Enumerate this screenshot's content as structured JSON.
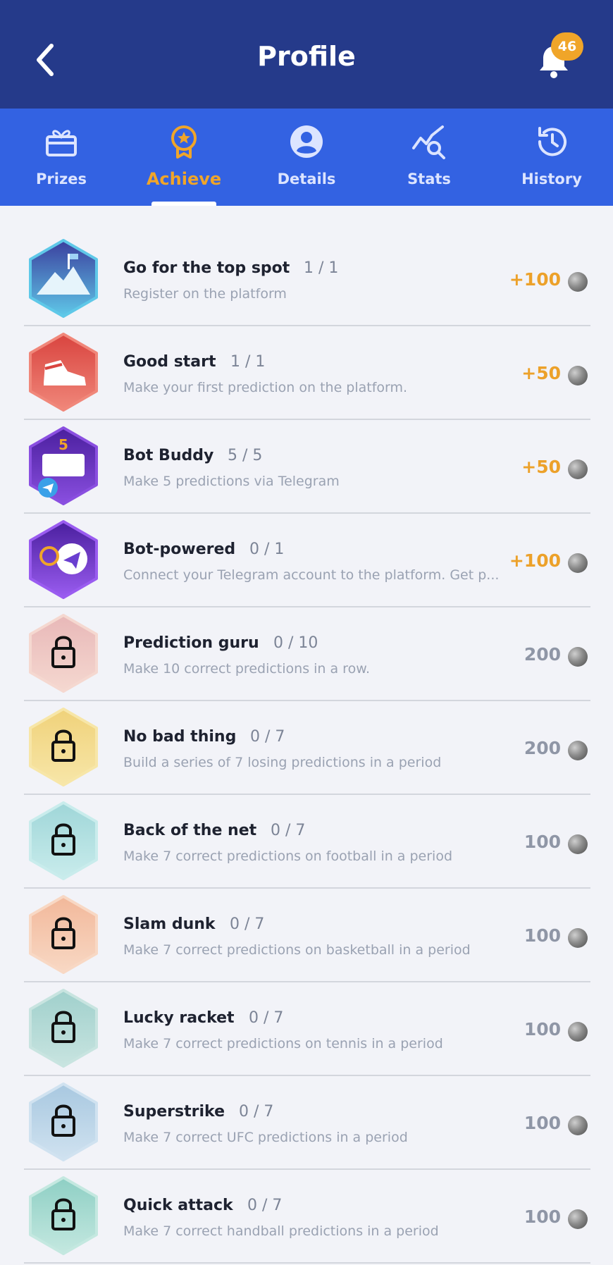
{
  "header": {
    "title": "Profile",
    "notification_count": "46"
  },
  "tabs": [
    {
      "label": "Prizes",
      "icon": "gift-icon",
      "active": false
    },
    {
      "label": "Achieve",
      "icon": "medal-icon",
      "active": true
    },
    {
      "label": "Details",
      "icon": "user-icon",
      "active": false
    },
    {
      "label": "Stats",
      "icon": "stats-chart-icon",
      "active": false
    },
    {
      "label": "History",
      "icon": "history-icon",
      "active": false
    }
  ],
  "colors": {
    "header_bg": "#253a8a",
    "tabbar_bg": "#3362e2",
    "accent": "#f0a529",
    "earned_reward": "#eca12a",
    "locked_reward": "#8f96a6"
  },
  "achievements": [
    {
      "name": "Go for the top spot",
      "progress": "1 / 1",
      "description": "Register on the platform",
      "reward": "+100",
      "earned": true,
      "badge": "mountain-flag-badge",
      "c1": "#3b3f9e",
      "c2": "#5fc8e8"
    },
    {
      "name": "Good start",
      "progress": "1 / 1",
      "description": "Make your first prediction on the platform.",
      "reward": "+50",
      "earned": true,
      "badge": "sneaker-badge",
      "c1": "#d9443f",
      "c2": "#f0877a"
    },
    {
      "name": "Bot Buddy",
      "progress": "5 / 5",
      "description": "Make 5 predictions via Telegram",
      "reward": "+50",
      "earned": true,
      "badge": "telegram-ticket-badge",
      "c1": "#4a1f9e",
      "c2": "#8a4fe0"
    },
    {
      "name": "Bot-powered",
      "progress": "0 / 1",
      "description": "Connect your Telegram account to the platform. Get p...",
      "reward": "+100",
      "earned": true,
      "badge": "telegram-bot-badge",
      "c1": "#4a1f9e",
      "c2": "#9a5cf0"
    },
    {
      "name": "Prediction guru",
      "progress": "0 / 10",
      "description": "Make 10 correct predictions in a row.",
      "reward": "200",
      "earned": false,
      "badge": "locked-badge",
      "c1": "#e8b8b8",
      "c2": "#f5d8d0"
    },
    {
      "name": "No bad thing",
      "progress": "0 / 7",
      "description": "Build a series of 7 losing predictions in a period",
      "reward": "200",
      "earned": false,
      "badge": "locked-badge",
      "c1": "#f0d27a",
      "c2": "#f7e6a8"
    },
    {
      "name": "Back of the net",
      "progress": "0 / 7",
      "description": "Make 7 correct predictions on football in a period",
      "reward": "100",
      "earned": false,
      "badge": "locked-badge",
      "c1": "#9fd6d8",
      "c2": "#c9ecec"
    },
    {
      "name": "Slam dunk",
      "progress": "0 / 7",
      "description": "Make 7 correct predictions on basketball in a period",
      "reward": "100",
      "earned": false,
      "badge": "locked-badge",
      "c1": "#f2b89a",
      "c2": "#f8d8c4"
    },
    {
      "name": "Lucky racket",
      "progress": "0 / 7",
      "description": "Make 7 correct predictions on tennis in a period",
      "reward": "100",
      "earned": false,
      "badge": "locked-badge",
      "c1": "#a0d0cc",
      "c2": "#c8e4e0"
    },
    {
      "name": "Superstrike",
      "progress": "0 / 7",
      "description": "Make 7 correct UFC predictions in a period",
      "reward": "100",
      "earned": false,
      "badge": "locked-badge",
      "c1": "#a8c8e0",
      "c2": "#d0e2f0"
    },
    {
      "name": "Quick attack",
      "progress": "0 / 7",
      "description": "Make 7 correct handball predictions in a period",
      "reward": "100",
      "earned": false,
      "badge": "locked-badge",
      "c1": "#8ecfc4",
      "c2": "#c4e8e0"
    }
  ]
}
